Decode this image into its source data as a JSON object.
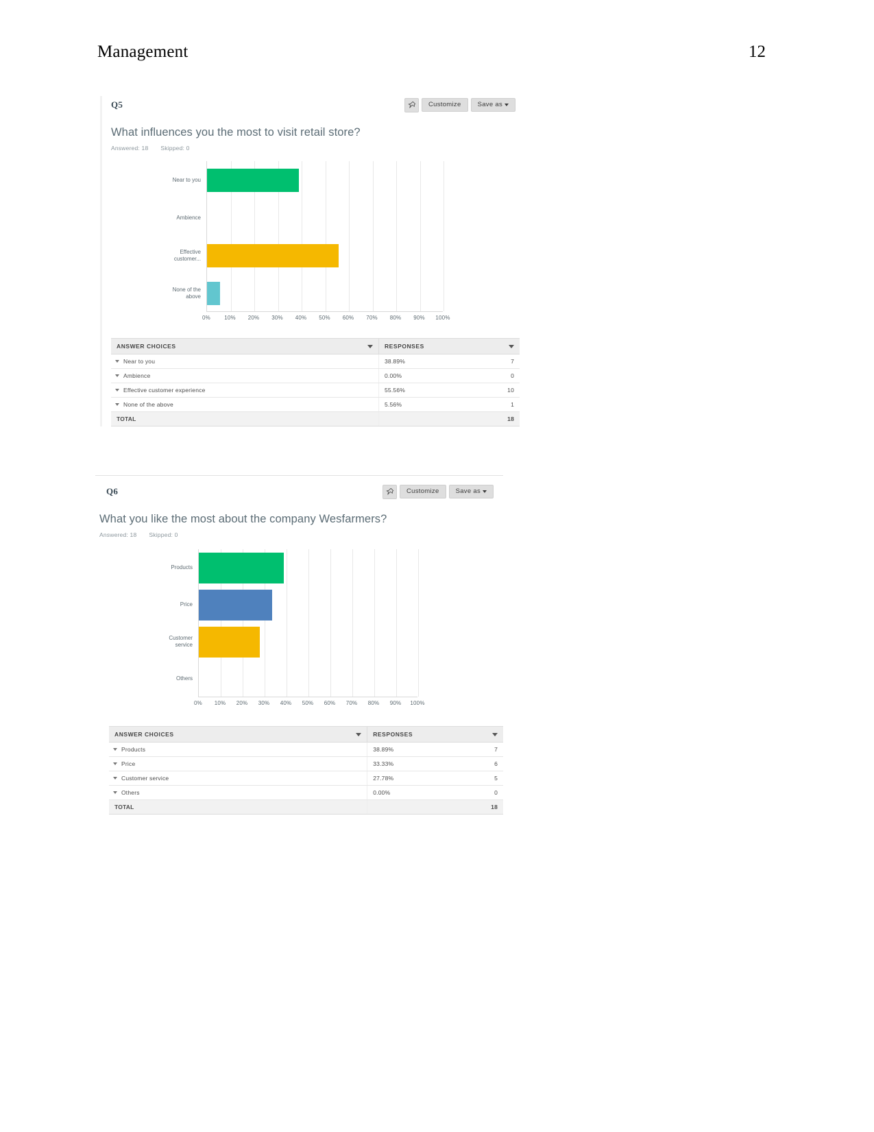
{
  "page": {
    "doc_title": "Management",
    "page_number": "12"
  },
  "toolbar": {
    "pin_icon": "pin-icon",
    "customize_label": "Customize",
    "save_as_label": "Save as",
    "caret_icon": "caret-down-icon"
  },
  "table_headers": {
    "answer_choices": "ANSWER CHOICES",
    "responses": "RESPONSES",
    "total_label": "TOTAL"
  },
  "axis_ticks": [
    "0%",
    "10%",
    "20%",
    "30%",
    "40%",
    "50%",
    "60%",
    "70%",
    "80%",
    "90%",
    "100%"
  ],
  "colors": {
    "green": "#00bf6f",
    "blue": "#4f81bd",
    "yellow": "#f5b800",
    "teal": "#62c6cf",
    "grid": "#e8e8e8",
    "axis": "#d8d8d8",
    "header_bg": "#ededed",
    "button_bg": "#dedede"
  },
  "questions": [
    {
      "qnum": "Q5",
      "title": "What influences you the most to visit retail store?",
      "answered_label": "Answered: 18",
      "skipped_label": "Skipped: 0",
      "total_value": "18",
      "rows": [
        {
          "label": "Near to you",
          "chart_label": "Near to you",
          "percent": "38.89%",
          "value": 38.89,
          "count": "7",
          "color": "#00bf6f"
        },
        {
          "label": "Ambience",
          "chart_label": "Ambience",
          "percent": "0.00%",
          "value": 0.0,
          "count": "0",
          "color": "#4f81bd"
        },
        {
          "label": "Effective customer experience",
          "chart_label": "Effective\ncustomer...",
          "percent": "55.56%",
          "value": 55.56,
          "count": "10",
          "color": "#f5b800"
        },
        {
          "label": "None of the above",
          "chart_label": "None of the\nabove",
          "percent": "5.56%",
          "value": 5.56,
          "count": "1",
          "color": "#62c6cf"
        }
      ]
    },
    {
      "qnum": "Q6",
      "title": "What you like the most about the company Wesfarmers?",
      "answered_label": "Answered: 18",
      "skipped_label": "Skipped: 0",
      "total_value": "18",
      "rows": [
        {
          "label": "Products",
          "chart_label": "Products",
          "percent": "38.89%",
          "value": 38.89,
          "count": "7",
          "color": "#00bf6f"
        },
        {
          "label": "Price",
          "chart_label": "Price",
          "percent": "33.33%",
          "value": 33.33,
          "count": "6",
          "color": "#4f81bd"
        },
        {
          "label": "Customer service",
          "chart_label": "Customer\nservice",
          "percent": "27.78%",
          "value": 27.78,
          "count": "5",
          "color": "#f5b800"
        },
        {
          "label": "Others",
          "chart_label": "Others",
          "percent": "0.00%",
          "value": 0.0,
          "count": "0",
          "color": "#62c6cf"
        }
      ]
    }
  ],
  "chart_data": [
    {
      "type": "bar",
      "orientation": "horizontal",
      "title": "What influences you the most to visit retail store?",
      "xlabel": "",
      "ylabel": "",
      "xlim": [
        0,
        100
      ],
      "grid": true,
      "legend": "none",
      "categories": [
        "Near to you",
        "Ambience",
        "Effective customer experience",
        "None of the above"
      ],
      "values": [
        38.89,
        0.0,
        55.56,
        5.56
      ],
      "counts": [
        7,
        0,
        10,
        1
      ],
      "total": 18,
      "tick_labels": [
        "0%",
        "10%",
        "20%",
        "30%",
        "40%",
        "50%",
        "60%",
        "70%",
        "80%",
        "90%",
        "100%"
      ],
      "bar_colors": [
        "#00bf6f",
        "#4f81bd",
        "#f5b800",
        "#62c6cf"
      ]
    },
    {
      "type": "bar",
      "orientation": "horizontal",
      "title": "What you like the most about the company Wesfarmers?",
      "xlabel": "",
      "ylabel": "",
      "xlim": [
        0,
        100
      ],
      "grid": true,
      "legend": "none",
      "categories": [
        "Products",
        "Price",
        "Customer service",
        "Others"
      ],
      "values": [
        38.89,
        33.33,
        27.78,
        0.0
      ],
      "counts": [
        7,
        6,
        5,
        0
      ],
      "total": 18,
      "tick_labels": [
        "0%",
        "10%",
        "20%",
        "30%",
        "40%",
        "50%",
        "60%",
        "70%",
        "80%",
        "90%",
        "100%"
      ],
      "bar_colors": [
        "#00bf6f",
        "#4f81bd",
        "#f5b800",
        "#62c6cf"
      ]
    }
  ]
}
